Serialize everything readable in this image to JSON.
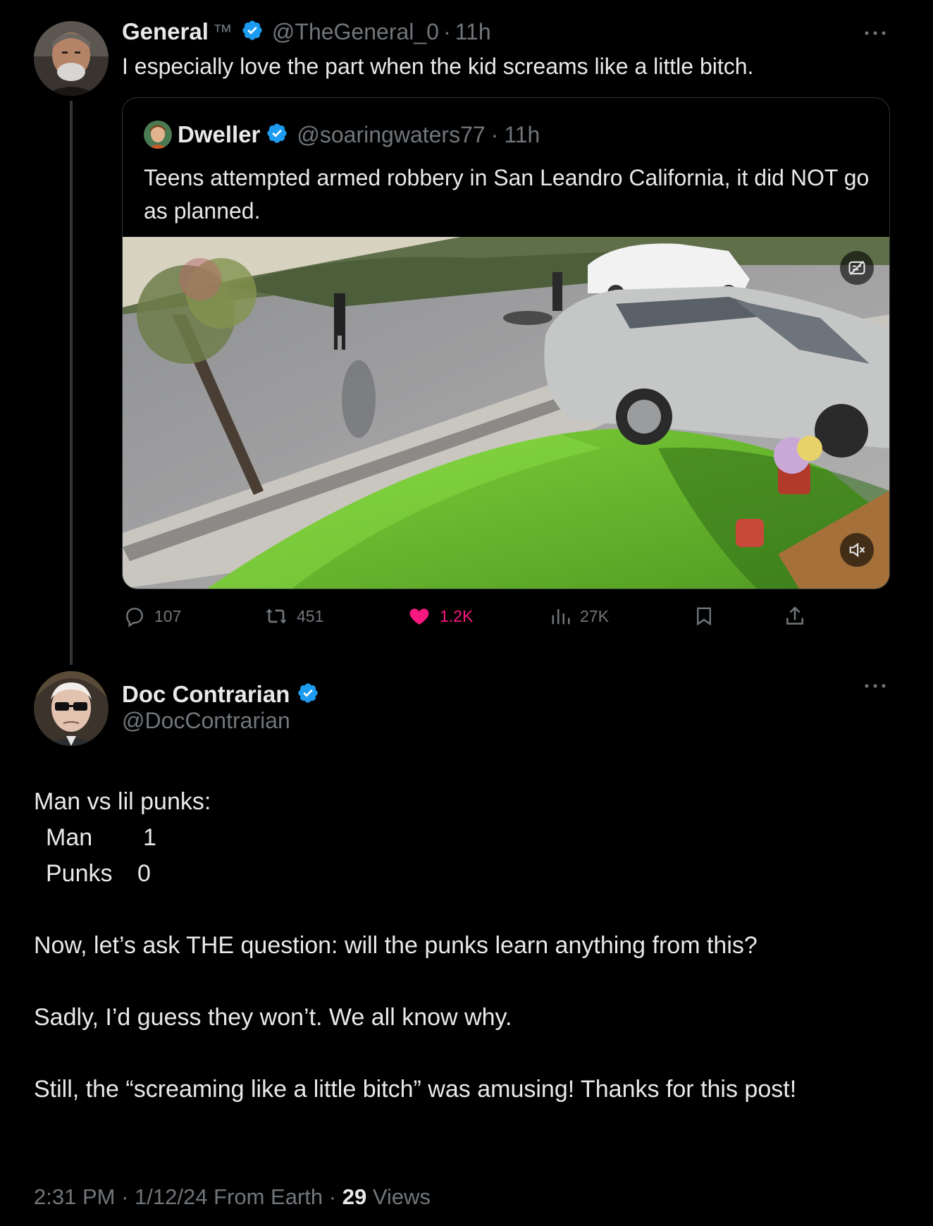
{
  "parent_tweet": {
    "display_name": "General",
    "name_suffix": "™",
    "handle": "@TheGeneral_0",
    "separator": "·",
    "time": "11h",
    "text": "I especially love the part when the kid screams like a little bitch.",
    "more_icon": "more-dots-icon",
    "quoted": {
      "display_name": "Dweller",
      "handle": "@soaringwaters77",
      "separator": "·",
      "time": "11h",
      "text": "Teens attempted armed robbery in San Leandro California, it did NOT go as planned.",
      "media": {
        "type": "video-still",
        "captions_icon": "captions-off-icon",
        "mute_icon": "muted-speaker-icon"
      }
    },
    "actions": {
      "replies": "107",
      "reposts": "451",
      "likes": "1.2K",
      "views": "27K",
      "liked": true
    }
  },
  "reply_tweet": {
    "display_name": "Doc Contrarian",
    "handle": "@DocContrarian",
    "more_icon": "more-dots-icon",
    "intro": "Man vs lil punks:",
    "scores": [
      {
        "label": "Man",
        "value": "1"
      },
      {
        "label": "Punks",
        "value": "0"
      }
    ],
    "paragraphs": [
      "Now, let’s ask THE question: will the punks learn anything from this?",
      "Sadly, I’d guess they won’t. We all know why.",
      "Still, the “screaming like a little bitch” was amusing! Thanks for this post!"
    ],
    "meta": {
      "time": "2:31 PM",
      "date": "1/12/24",
      "source": "From Earth",
      "views_count": "29",
      "views_label": "Views",
      "separator": "·"
    }
  },
  "colors": {
    "background": "#000000",
    "text": "#e7e9ea",
    "muted": "#71767b",
    "verified": "#1d9bf0",
    "like": "#f91880",
    "border": "#2f3336"
  }
}
